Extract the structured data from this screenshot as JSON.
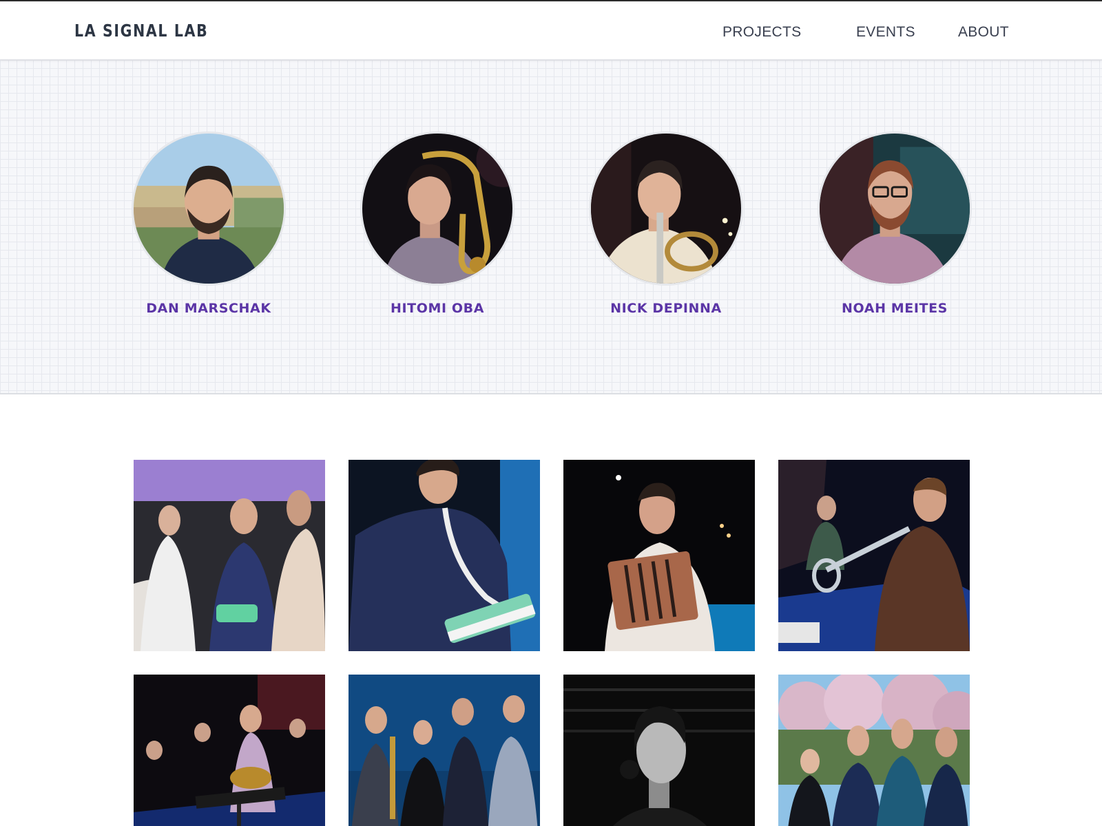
{
  "site": {
    "brand": "LA SIGNAL LAB",
    "nav": [
      {
        "label": "PROJECTS"
      },
      {
        "label": "EVENTS"
      },
      {
        "label": "ABOUT"
      }
    ]
  },
  "members": [
    {
      "name": "DAN MARSCHAK"
    },
    {
      "name": "HITOMI OBA"
    },
    {
      "name": "NICK DEPINNA"
    },
    {
      "name": "NOAH MEITES"
    }
  ],
  "colors": {
    "accent": "#5b35a6",
    "header_text": "#2d3644",
    "nav_text": "#3a4050",
    "band_background": "#f6f7fa"
  }
}
